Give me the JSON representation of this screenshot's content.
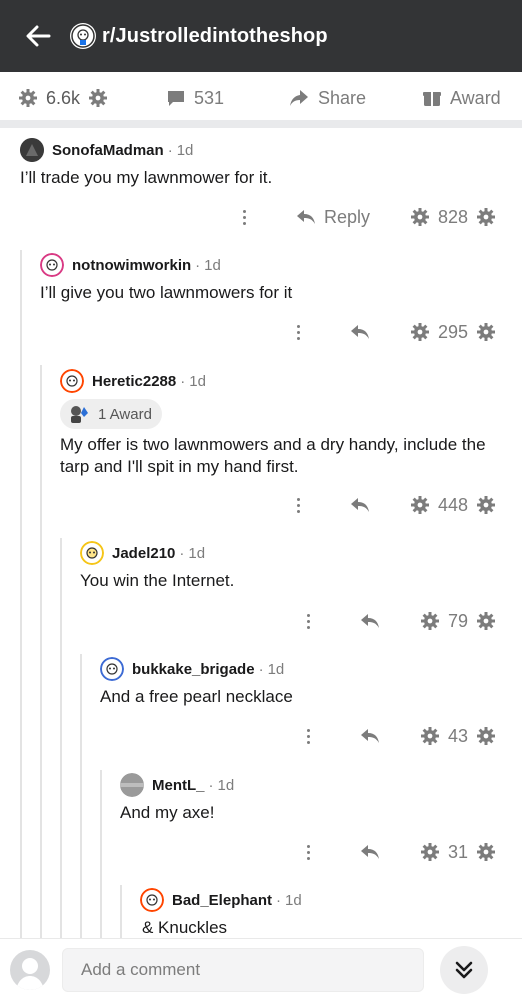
{
  "header": {
    "subreddit": "r/Justrolledintotheshop"
  },
  "post_actions": {
    "score": "6.6k",
    "comments": "531",
    "share": "Share",
    "award": "Award"
  },
  "comments": [
    {
      "author": "SonofaMadman",
      "age": "1d",
      "body": "I’ll trade you my lawnmower for it.",
      "reply_label": "Reply",
      "score": "828"
    },
    {
      "author": "notnowimworkin",
      "age": "1d",
      "body": "I’ll give you two lawnmowers for it",
      "score": "295"
    },
    {
      "author": "Heretic2288",
      "age": "1d",
      "award": "1 Award",
      "body_line1": "My offer is two lawnmowers and a dry handy, include the",
      "body_line2": "tarp and I'll spit in my hand first.",
      "score": "448"
    },
    {
      "author": "Jadel210",
      "age": "1d",
      "body": "You win the Internet.",
      "score": "79"
    },
    {
      "author": "bukkake_brigade",
      "age": "1d",
      "body": "And a free pearl necklace",
      "score": "43"
    },
    {
      "author": "MentL_",
      "age": "1d",
      "body": "And my axe!",
      "score": "31"
    },
    {
      "author": "Bad_Elephant",
      "age": "1d",
      "body": "& Knuckles"
    }
  ],
  "bottom": {
    "placeholder": "Add a comment"
  },
  "colors": {
    "header_bg": "#333436",
    "text_muted": "#7c7c7c",
    "thread_line": "#e3e3e3",
    "snoo_red": "#ff4500"
  }
}
